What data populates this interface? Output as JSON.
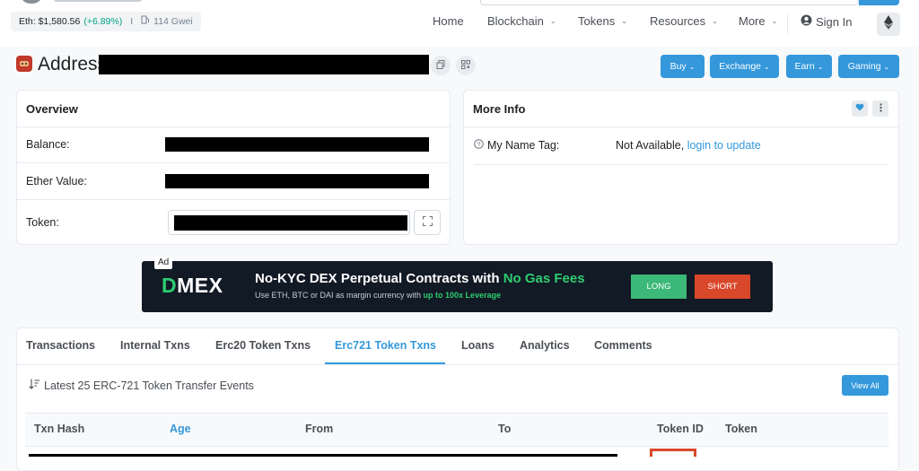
{
  "colors": {
    "accent": "#3498db",
    "positive": "#00a186",
    "ad_green": "#2ecc71",
    "ad_long": "#3cb878",
    "ad_short": "#d9472b"
  },
  "header": {
    "eth_price_label": "Eth: $1,580.56",
    "eth_change": "(+6.89%)",
    "divider": "I",
    "gas": "114 Gwei",
    "nav": {
      "home": "Home",
      "blockchain": "Blockchain",
      "tokens": "Tokens",
      "resources": "Resources",
      "more": "More",
      "signin": "Sign In"
    },
    "caret": "⌄"
  },
  "address_bar": {
    "title": "Address",
    "buttons": {
      "buy": "Buy",
      "exchange": "Exchange",
      "earn": "Earn",
      "gaming": "Gaming"
    }
  },
  "overview": {
    "title": "Overview",
    "balance_label": "Balance:",
    "ether_value_label": "Ether Value:",
    "token_label": "Token:"
  },
  "more_info": {
    "title": "More Info",
    "name_tag_label": "My Name Tag:",
    "name_tag_value": "Not Available,",
    "name_tag_link": "login to update"
  },
  "ad": {
    "tag": "Ad",
    "logo_d": "D",
    "logo_rest": "MEX",
    "headline_main": "No-KYC DEX Perpetual Contracts with ",
    "headline_accent": "No Gas Fees",
    "subline_main": "Use ETH, BTC or DAI as margin currency with ",
    "subline_accent": "up to 100x Leverage",
    "long_label": "LONG",
    "short_label": "SHORT"
  },
  "tabs": {
    "items": [
      "Transactions",
      "Internal Txns",
      "Erc20 Token Txns",
      "Erc721 Token Txns",
      "Loans",
      "Analytics",
      "Comments"
    ],
    "active_index": 3
  },
  "events": {
    "heading": "Latest 25 ERC-721 Token Transfer Events",
    "view_all": "View All",
    "columns": [
      "Txn Hash",
      "Age",
      "From",
      "To",
      "Token ID",
      "Token"
    ]
  }
}
